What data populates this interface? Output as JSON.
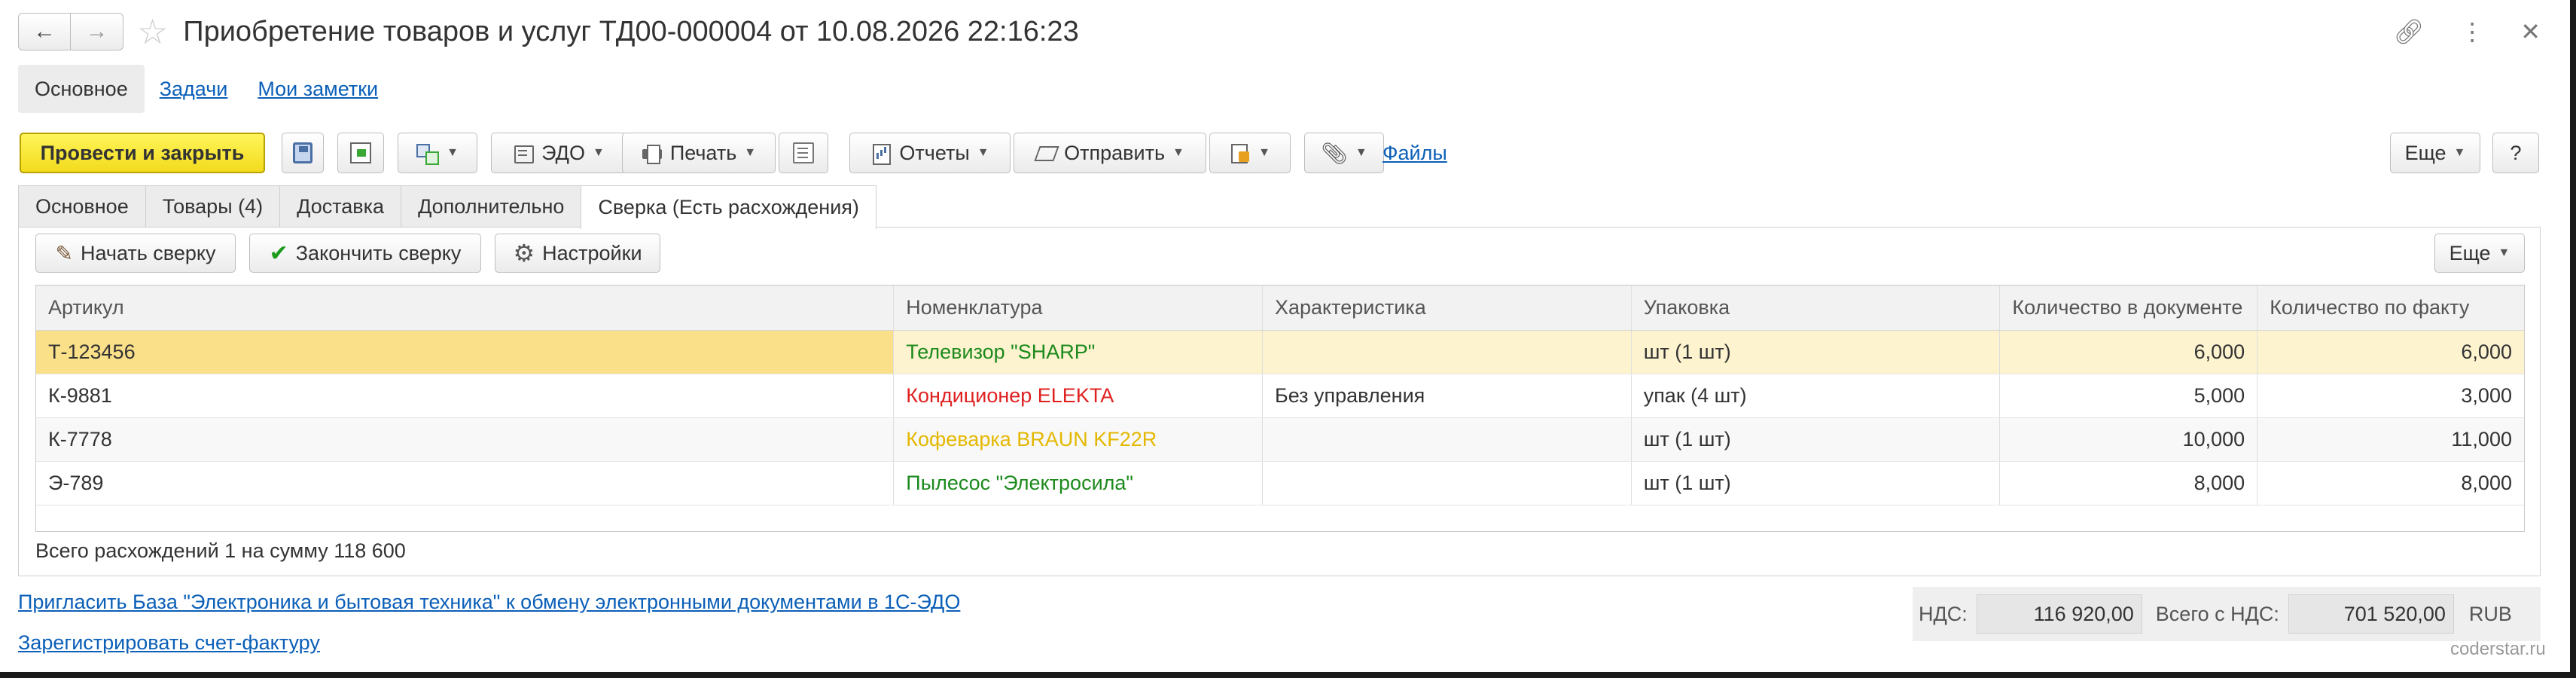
{
  "window": {
    "title": "Приобретение товаров и услуг ТД00-000004 от 10.08.2026 22:16:23"
  },
  "sections": [
    {
      "label": "Основное"
    },
    {
      "label": "Задачи"
    },
    {
      "label": "Мои заметки"
    }
  ],
  "toolbar": {
    "post_close": "Провести и закрыть",
    "edo": "ЭДО",
    "print": "Печать",
    "reports": "Отчеты",
    "send": "Отправить",
    "files": "Файлы",
    "more": "Еще",
    "help": "?"
  },
  "tabs": [
    {
      "label": "Основное"
    },
    {
      "label": "Товары (4)"
    },
    {
      "label": "Доставка"
    },
    {
      "label": "Дополнительно"
    },
    {
      "label": "Сверка (Есть расхождения)"
    }
  ],
  "reconciliation": {
    "start": "Начать сверку",
    "finish": "Закончить сверку",
    "settings": "Настройки",
    "more": "Еще",
    "columns": [
      "Артикул",
      "Номенклатура",
      "Характеристика",
      "Упаковка",
      "Количество в документе",
      "Количество по факту"
    ],
    "rows": [
      {
        "article": "Т-123456",
        "item": "Телевизор \"SHARP\"",
        "characteristic": "",
        "package": "шт (1 шт)",
        "qty_doc": "6,000",
        "qty_fact": "6,000"
      },
      {
        "article": "К-9881",
        "item": "Кондиционер ELEKTA",
        "characteristic": "Без управления",
        "package": "упак (4 шт)",
        "qty_doc": "5,000",
        "qty_fact": "3,000"
      },
      {
        "article": "К-7778",
        "item": "Кофеварка BRAUN KF22R",
        "characteristic": "",
        "package": "шт (1 шт)",
        "qty_doc": "10,000",
        "qty_fact": "11,000"
      },
      {
        "article": "Э-789",
        "item": "Пылесос \"Электросила\"",
        "characteristic": "",
        "package": "шт (1 шт)",
        "qty_doc": "8,000",
        "qty_fact": "8,000"
      }
    ],
    "summary": "Всего расхождений 1 на сумму 118 600"
  },
  "footer": {
    "invite_link": "Пригласить База \"Электроника и бытовая техника\" к обмену электронными документами в 1С-ЭДО",
    "invoice_link": "Зарегистрировать счет-фактуру",
    "vat_label": "НДС:",
    "vat_value": "116 920,00",
    "total_label": "Всего с НДС:",
    "total_value": "701 520,00",
    "currency": "RUB"
  },
  "watermark": "coderstar.ru",
  "colors": {
    "primary_button": "#f3db1d",
    "link": "#0b5fb8",
    "selected_row": "#fdf3cf",
    "status_ok": "#1c8a1c",
    "status_shortage": "#e02020",
    "status_excess": "#e4b800"
  }
}
